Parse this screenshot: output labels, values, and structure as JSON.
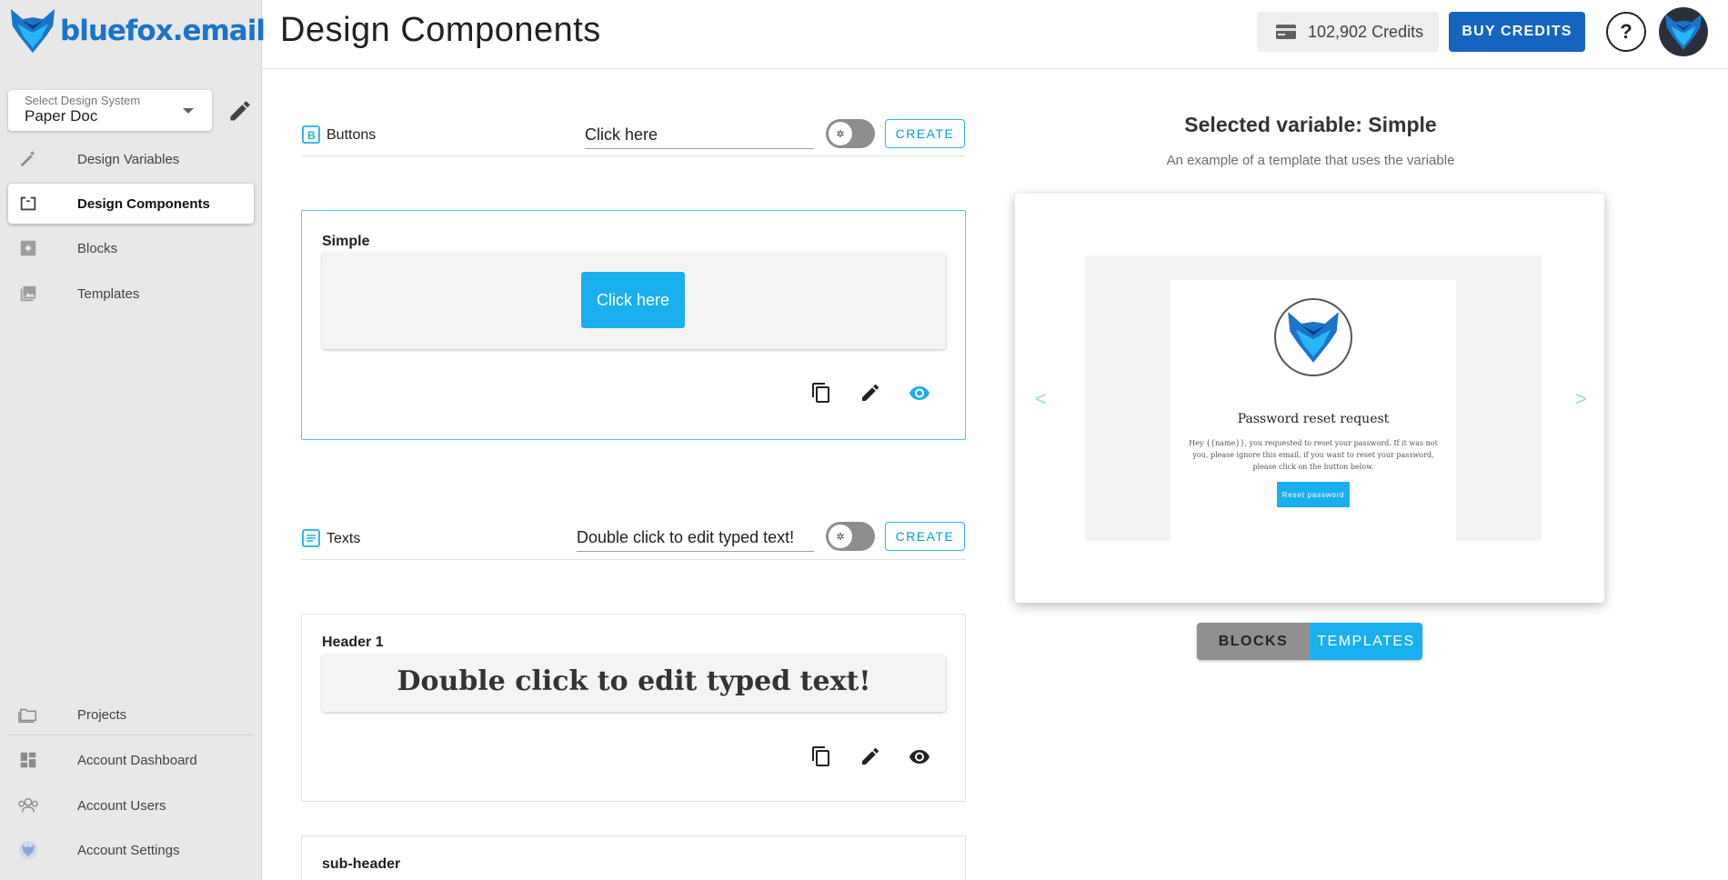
{
  "app": {
    "brand": "bluefox.email"
  },
  "sidebar": {
    "design_system": {
      "label": "Select Design System",
      "value": "Paper Doc"
    },
    "items": [
      {
        "label": "Design Variables",
        "icon": "magic-wand-icon"
      },
      {
        "label": "Design Components",
        "icon": "component-icon",
        "active": true
      },
      {
        "label": "Blocks",
        "icon": "block-icon"
      },
      {
        "label": "Templates",
        "icon": "image-stack-icon"
      }
    ],
    "bottom_items": [
      {
        "label": "Projects",
        "icon": "folder-icon"
      },
      {
        "label": "Account Dashboard",
        "icon": "dashboard-icon"
      },
      {
        "label": "Account Users",
        "icon": "users-icon"
      },
      {
        "label": "Account Settings",
        "icon": "settings-icon"
      }
    ]
  },
  "header": {
    "title": "Design Components",
    "credits": "102,902 Credits",
    "buy_label": "BUY CREDITS",
    "help_label": "?"
  },
  "sections": {
    "buttons": {
      "title": "Buttons",
      "input_value": "Click here",
      "create_label": "CREATE",
      "cards": [
        {
          "label": "Simple",
          "preview_text": "Click here",
          "selected": true
        }
      ]
    },
    "texts": {
      "title": "Texts",
      "input_value": "Double click to edit typed text!",
      "create_label": "CREATE",
      "cards": [
        {
          "label": "Header 1",
          "preview_text": "Double click to edit typed text!"
        },
        {
          "label": "sub-header"
        }
      ]
    }
  },
  "preview_panel": {
    "title": "Selected variable: Simple",
    "subtitle": "An example of a template that uses the variable",
    "email": {
      "heading": "Password reset request",
      "body": "Hey {{name}}, you requested to reset your password. If it was not you, please ignore this email, if you want to reset your password, please click on the button below.",
      "button": "Reset password"
    },
    "prev_arrow": "<",
    "next_arrow": ">",
    "tabs": {
      "blocks": "BLOCKS",
      "templates": "TEMPLATES",
      "active": "templates"
    }
  },
  "colors": {
    "primary": "#1565c0",
    "accent": "#1ab0ef",
    "sidebar_bg": "#e8e8e8"
  }
}
